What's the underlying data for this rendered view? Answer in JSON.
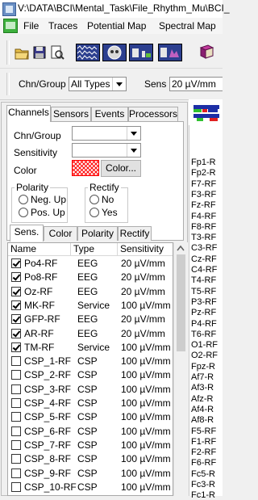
{
  "window": {
    "title": "V:\\DATA\\BCI\\Mental_Task\\File_Rhythm_Mu\\BCI_"
  },
  "menu": [
    "File",
    "Traces",
    "Potential Map",
    "Spectral Map"
  ],
  "toolbar": {
    "icons": [
      "open-folder-icon",
      "save-icon",
      "print-preview-icon",
      "montage-view-icon",
      "head-map-icon",
      "spectrum-icon",
      "spectrum-3d-icon",
      "book-icon"
    ]
  },
  "chn_row": {
    "chn_group_label": "Chn/Group",
    "chn_group_value": "All Types",
    "sens_label": "Sens",
    "sens_value": "20 µV/mm"
  },
  "tabs": [
    "Channels",
    "Sensors",
    "Events",
    "Processors"
  ],
  "props": {
    "chn_group_label": "Chn/Group",
    "sensitivity_label": "Sensitivity",
    "color_label": "Color",
    "color_button": "Color...",
    "color_swatch": "#ff0000"
  },
  "polarity": {
    "title": "Polarity",
    "options": [
      "Neg. Up",
      "Pos. Up"
    ]
  },
  "rectify": {
    "title": "Rectify",
    "options": [
      "No",
      "Yes"
    ]
  },
  "subtabs": [
    "Sens.",
    "Color",
    "Polarity",
    "Rectify"
  ],
  "table": {
    "headers": [
      "Name",
      "Type",
      "Sensitivity"
    ],
    "rows": [
      {
        "checked": true,
        "name": "Po4-RF",
        "type": "EEG",
        "sens": "20 µV/mm"
      },
      {
        "checked": true,
        "name": "Po8-RF",
        "type": "EEG",
        "sens": "20 µV/mm"
      },
      {
        "checked": true,
        "name": "Oz-RF",
        "type": "EEG",
        "sens": "20 µV/mm"
      },
      {
        "checked": true,
        "name": "MK-RF",
        "type": "Service",
        "sens": "100 µV/mm"
      },
      {
        "checked": true,
        "name": "GFP-RF",
        "type": "EEG",
        "sens": "20 µV/mm"
      },
      {
        "checked": true,
        "name": "AR-RF",
        "type": "EEG",
        "sens": "20 µV/mm"
      },
      {
        "checked": true,
        "name": "TM-RF",
        "type": "Service",
        "sens": "100 µV/mm"
      },
      {
        "checked": false,
        "name": "CSP_1-RF",
        "type": "CSP",
        "sens": "100 µV/mm"
      },
      {
        "checked": false,
        "name": "CSP_2-RF",
        "type": "CSP",
        "sens": "100 µV/mm"
      },
      {
        "checked": false,
        "name": "CSP_3-RF",
        "type": "CSP",
        "sens": "100 µV/mm"
      },
      {
        "checked": false,
        "name": "CSP_4-RF",
        "type": "CSP",
        "sens": "100 µV/mm"
      },
      {
        "checked": false,
        "name": "CSP_5-RF",
        "type": "CSP",
        "sens": "100 µV/mm"
      },
      {
        "checked": false,
        "name": "CSP_6-RF",
        "type": "CSP",
        "sens": "100 µV/mm"
      },
      {
        "checked": false,
        "name": "CSP_7-RF",
        "type": "CSP",
        "sens": "100 µV/mm"
      },
      {
        "checked": false,
        "name": "CSP_8-RF",
        "type": "CSP",
        "sens": "100 µV/mm"
      },
      {
        "checked": false,
        "name": "CSP_9-RF",
        "type": "CSP",
        "sens": "100 µV/mm"
      },
      {
        "checked": false,
        "name": "CSP_10-RF",
        "type": "CSP",
        "sens": "100 µV/mm"
      }
    ]
  },
  "right_channels": [
    "Fp1-R",
    "Fp2-R",
    "F7-RF",
    "F3-RF",
    "Fz-RF",
    "F4-RF",
    "F8-RF",
    "T3-RF",
    "C3-RF",
    "Cz-RF",
    "C4-RF",
    "T4-RF",
    "T5-RF",
    "P3-RF",
    "Pz-RF",
    "P4-RF",
    "T6-RF",
    "O1-RF",
    "O2-RF",
    "Fpz-R",
    "Af7-R",
    "Af3-R",
    "Afz-R",
    "Af4-R",
    "Af8-R",
    "F5-RF",
    "F1-RF",
    "F2-RF",
    "F6-RF",
    "Fc5-R",
    "Fc3-R",
    "Fc1-R"
  ]
}
